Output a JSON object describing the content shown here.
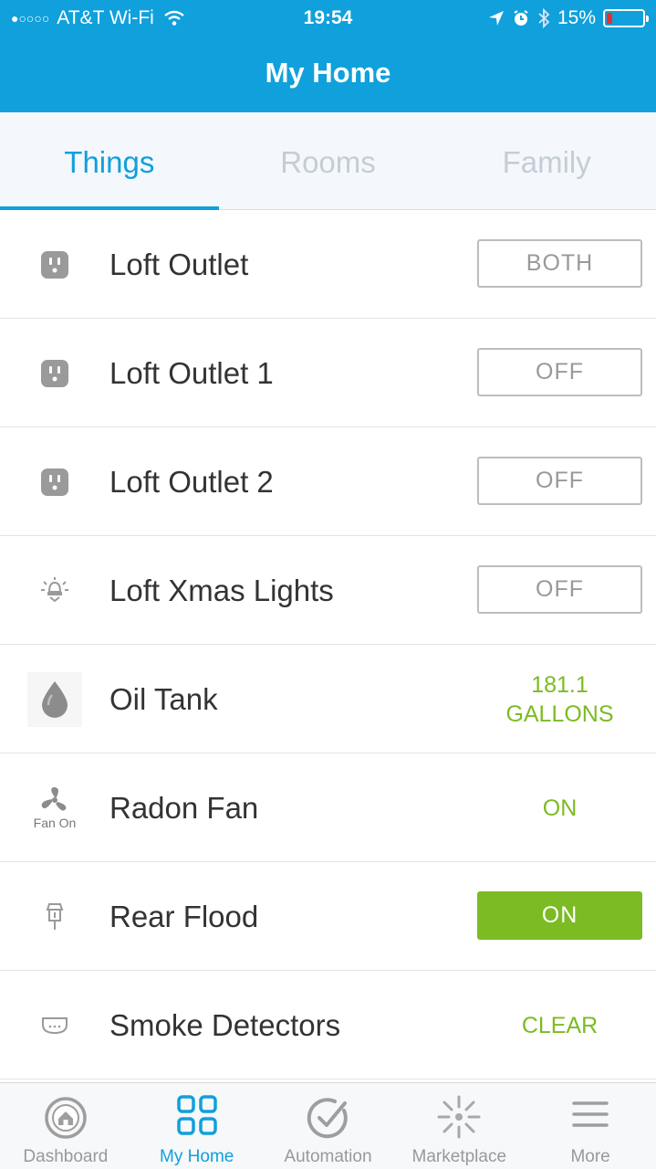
{
  "status_bar": {
    "carrier": "AT&T Wi-Fi",
    "signal_dots": "●○○○○",
    "time": "19:54",
    "battery": "15%",
    "battery_level": 0.15
  },
  "header": {
    "title": "My Home"
  },
  "tabs": [
    {
      "label": "Things",
      "active": true
    },
    {
      "label": "Rooms",
      "active": false
    },
    {
      "label": "Family",
      "active": false
    }
  ],
  "devices": [
    {
      "name": "Loft Outlet",
      "icon": "outlet-icon",
      "control": "BOTH"
    },
    {
      "name": "Loft Outlet 1",
      "icon": "outlet-icon",
      "control": "OFF"
    },
    {
      "name": "Loft Outlet 2",
      "icon": "outlet-icon",
      "control": "OFF"
    },
    {
      "name": "Loft Xmas Lights",
      "icon": "light-icon",
      "control": "OFF"
    },
    {
      "name": "Oil Tank",
      "icon": "oil-drop-icon",
      "value_line1": "181.1",
      "value_line2": "GALLONS"
    },
    {
      "name": "Radon Fan",
      "icon": "fan-icon",
      "icon_label": "Fan On",
      "status": "ON"
    },
    {
      "name": "Rear Flood",
      "icon": "lantern-icon",
      "control": "ON"
    },
    {
      "name": "Smoke Detectors",
      "icon": "smoke-detector-icon",
      "status": "CLEAR"
    }
  ],
  "tabbar": [
    {
      "label": "Dashboard",
      "icon": "dashboard-icon",
      "active": false
    },
    {
      "label": "My Home",
      "icon": "grid-icon",
      "active": true
    },
    {
      "label": "Automation",
      "icon": "check-circle-icon",
      "active": false
    },
    {
      "label": "Marketplace",
      "icon": "marketplace-icon",
      "active": false
    },
    {
      "label": "More",
      "icon": "menu-icon",
      "active": false
    }
  ],
  "colors": {
    "header": "#10a0dc",
    "accent": "#11a0dc",
    "on_green": "#7cbb23",
    "battery_low": "#e8302a"
  }
}
